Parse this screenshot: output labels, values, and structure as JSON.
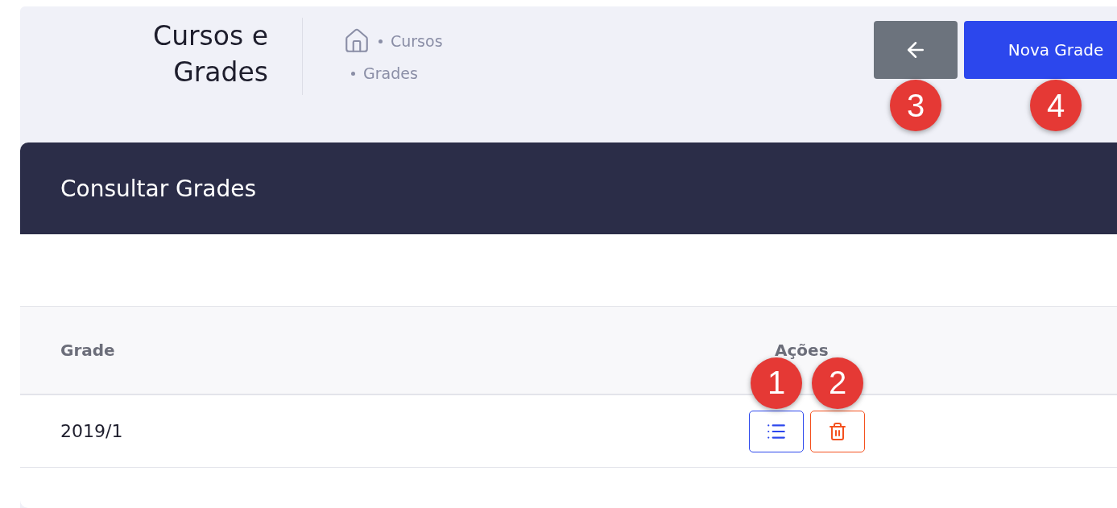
{
  "header": {
    "title": "Cursos e Grades",
    "breadcrumb": [
      "Cursos",
      "Grades"
    ]
  },
  "toolbar": [
    {
      "kind": "back",
      "badge": "3"
    },
    {
      "kind": "primary",
      "label": "Nova Grade",
      "badge": "4"
    }
  ],
  "card": {
    "title": "Consultar Grades"
  },
  "table": {
    "columns": [
      "Grade",
      "Ações"
    ],
    "rows": [
      {
        "grade": "2019/1",
        "actions": [
          {
            "kind": "details",
            "badge": "1"
          },
          {
            "kind": "delete",
            "badge": "2"
          }
        ]
      }
    ]
  }
}
